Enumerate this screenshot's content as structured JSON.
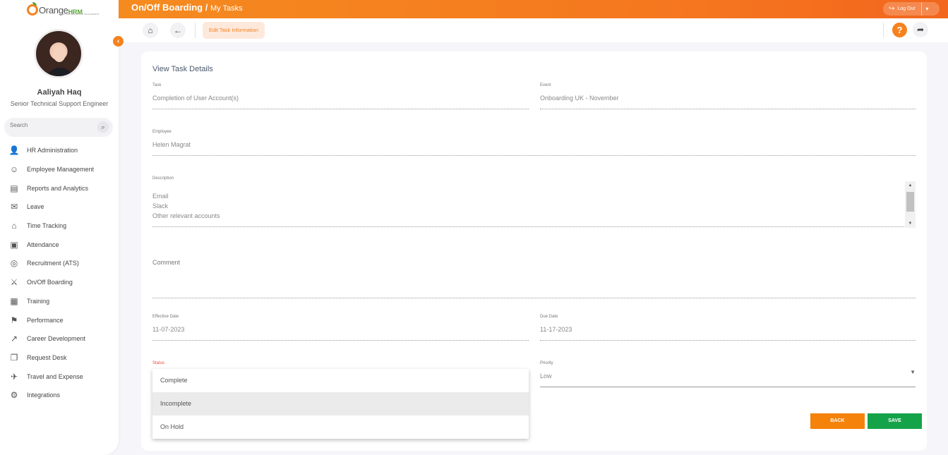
{
  "brand": {
    "name_orange": "Orange",
    "name_hrm": "HRM",
    "tagline": "HUMAN CENTRIC HR MANAGEMENT"
  },
  "user": {
    "name": "Aaliyah Haq",
    "title": "Senior Technical Support Engineer"
  },
  "search": {
    "placeholder": "Search"
  },
  "menu": [
    {
      "label": "HR Administration",
      "icon": "hr-admin-icon"
    },
    {
      "label": "Employee Management",
      "icon": "employees-icon"
    },
    {
      "label": "Reports and Analytics",
      "icon": "reports-icon"
    },
    {
      "label": "Leave",
      "icon": "leave-icon"
    },
    {
      "label": "Time Tracking",
      "icon": "time-icon"
    },
    {
      "label": "Attendance",
      "icon": "attendance-icon"
    },
    {
      "label": "Recruitment (ATS)",
      "icon": "recruitment-icon"
    },
    {
      "label": "On/Off Boarding",
      "icon": "handshake-icon"
    },
    {
      "label": "Training",
      "icon": "training-icon"
    },
    {
      "label": "Performance",
      "icon": "performance-icon"
    },
    {
      "label": "Career Development",
      "icon": "career-icon"
    },
    {
      "label": "Request Desk",
      "icon": "request-icon"
    },
    {
      "label": "Travel and Expense",
      "icon": "plane-icon"
    },
    {
      "label": "Integrations",
      "icon": "puzzle-icon"
    }
  ],
  "header": {
    "module": "On/Off Boarding",
    "separator": " / ",
    "page": "My Tasks",
    "logout_label": "Log Out"
  },
  "toolbar": {
    "edit_pill": "Edit Task Information",
    "help": "?"
  },
  "form": {
    "title": "View Task Details",
    "task": {
      "label": "Task",
      "value": "Completion of User Account(s)"
    },
    "event": {
      "label": "Event",
      "value": "Onboarding UK - November"
    },
    "employee": {
      "label": "Employee",
      "value": "Helen Magrat"
    },
    "description": {
      "label": "Description",
      "lines": [
        "Email",
        "Slack",
        "Other relevant accounts"
      ]
    },
    "comment": {
      "label": "Comment",
      "value": ""
    },
    "effective_date": {
      "label": "Effective Date",
      "value": "11-07-2023"
    },
    "due_date": {
      "label": "Due Date",
      "value": "11-17-2023"
    },
    "status": {
      "label": "Status",
      "options": [
        "Complete",
        "Incomplete",
        "On Hold"
      ],
      "highlighted": "Incomplete"
    },
    "priority": {
      "label": "Priority",
      "value": "Low"
    }
  },
  "buttons": {
    "back": "BACK",
    "save": "SAVE"
  },
  "colors": {
    "accent": "#f5821f",
    "save": "#15a34a",
    "status_label": "#e84b3c"
  }
}
